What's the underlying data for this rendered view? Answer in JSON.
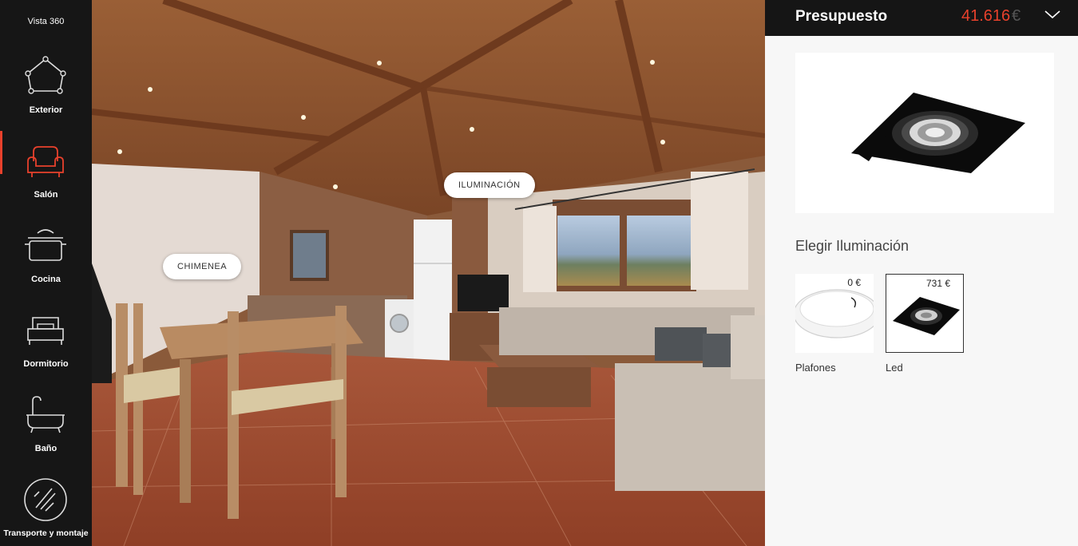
{
  "sidebar": {
    "vista_label": "Vista 360",
    "items": [
      {
        "label": "Exterior",
        "icon": "house-outline-icon"
      },
      {
        "label": "Salón",
        "icon": "armchair-icon",
        "active": true
      },
      {
        "label": "Cocina",
        "icon": "cooking-pot-icon"
      },
      {
        "label": "Dormitorio",
        "icon": "bed-icon"
      },
      {
        "label": "Baño",
        "icon": "bathtub-icon"
      },
      {
        "label": "Transporte y montaje",
        "icon": "crane-circle-icon"
      }
    ],
    "accent": "#e8412c"
  },
  "scene": {
    "hotspots": {
      "iluminacion": "ILUMINACIÓN",
      "chimenea": "CHIMENEA"
    }
  },
  "panel": {
    "title": "Presupuesto",
    "price": "41.616",
    "currency": "€",
    "section_title": "Elegir Iluminación",
    "options": [
      {
        "name": "Plafones",
        "price": "0 €",
        "icon": "ceiling-light-icon",
        "selected": false
      },
      {
        "name": "Led",
        "price": "731 €",
        "icon": "led-downlight-icon",
        "selected": true
      }
    ]
  }
}
